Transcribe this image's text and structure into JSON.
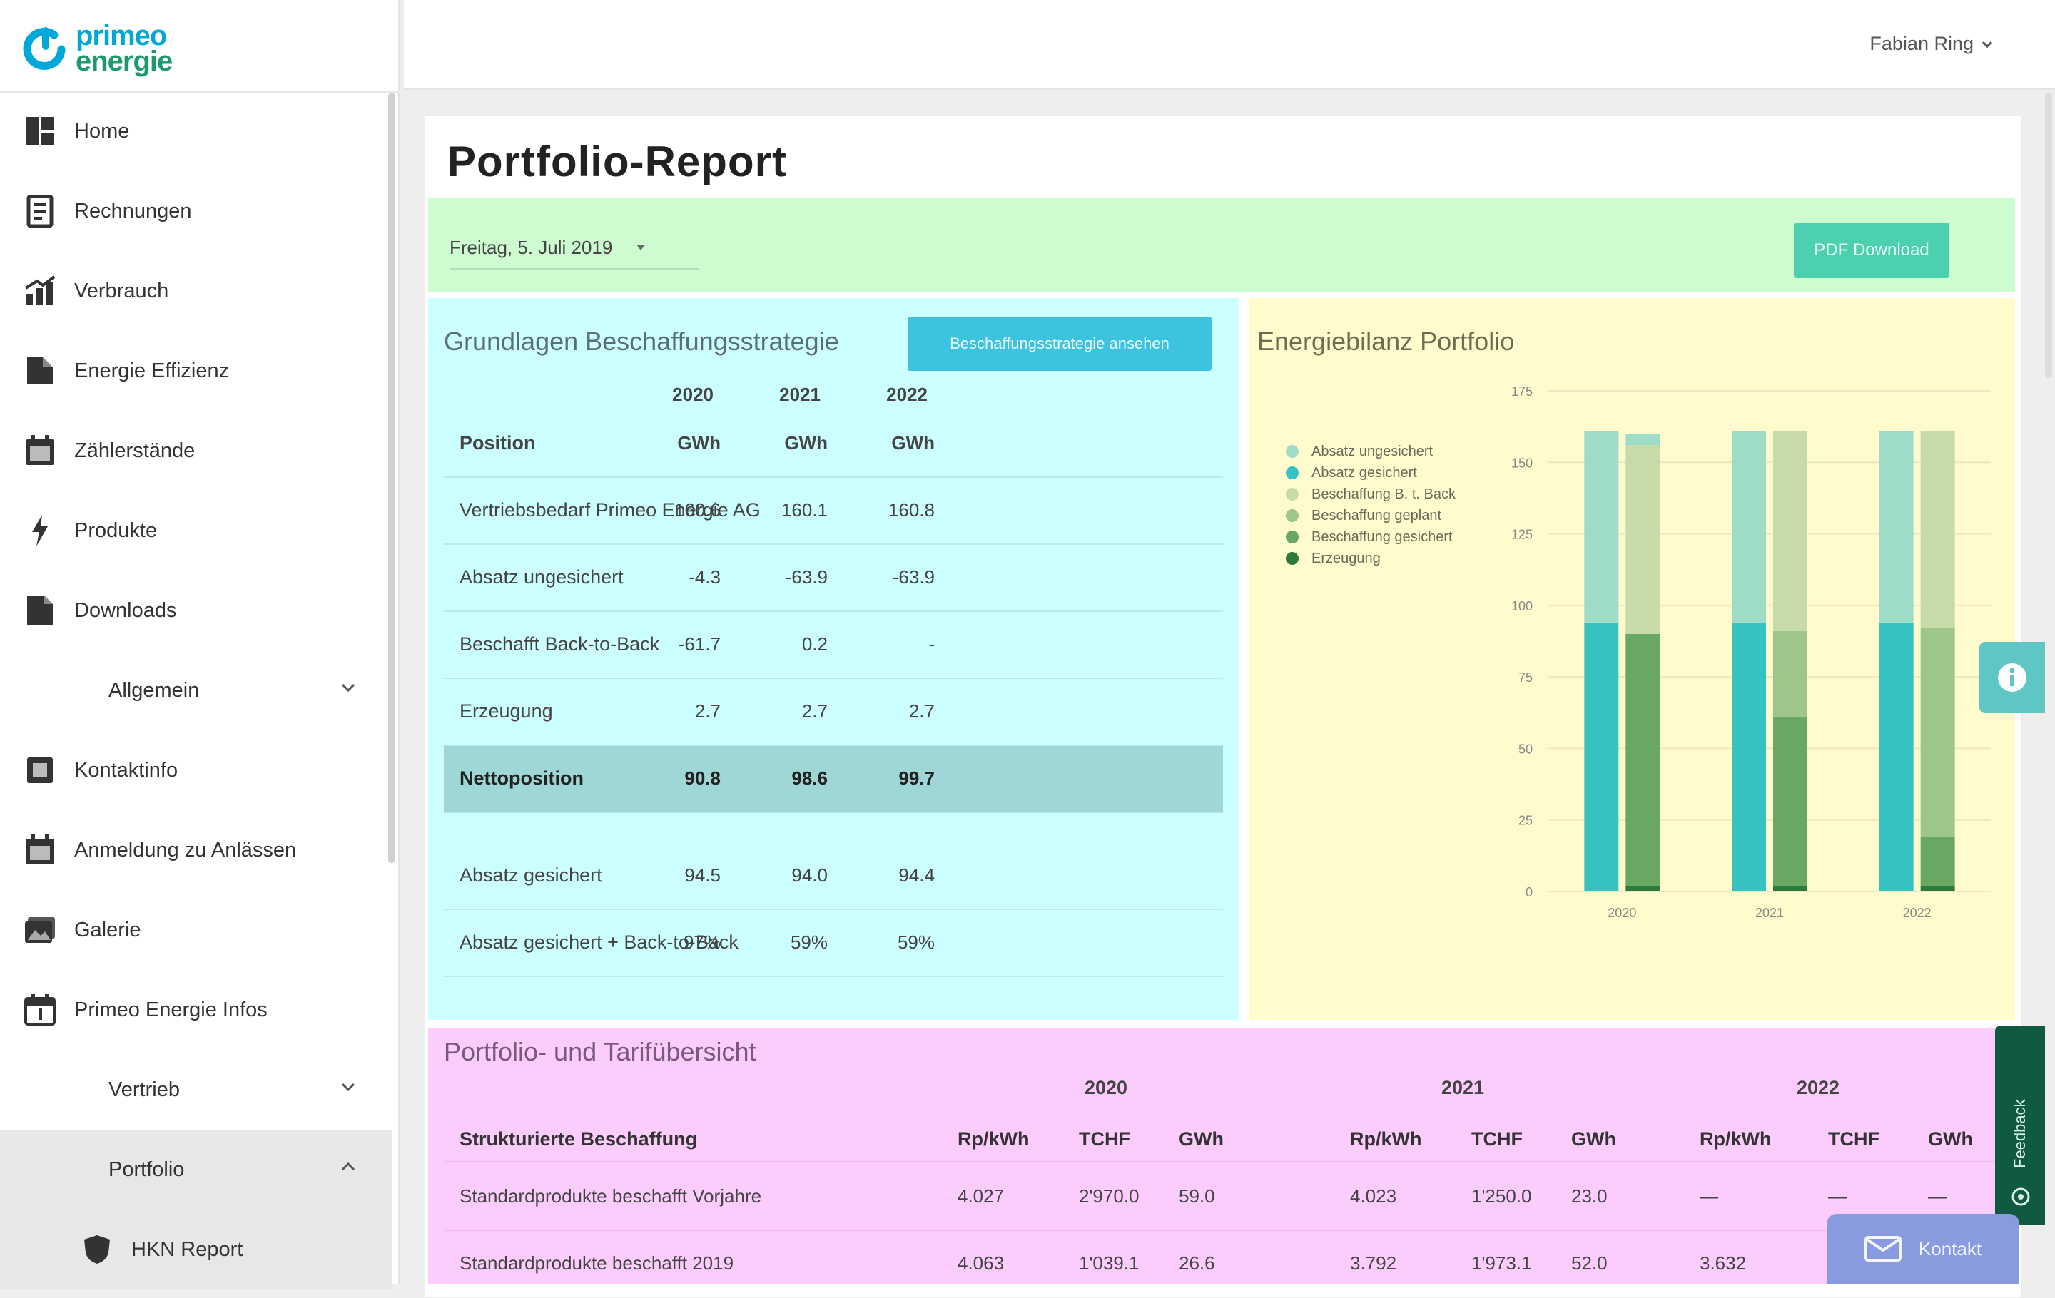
{
  "brand": {
    "line1": "primeo",
    "line2": "energie"
  },
  "user": {
    "name": "Fabian Ring"
  },
  "sidebar": {
    "items": [
      {
        "label": "Home",
        "icon": "dashboard-icon"
      },
      {
        "label": "Rechnungen",
        "icon": "invoice-icon"
      },
      {
        "label": "Verbrauch",
        "icon": "consumption-chart-icon"
      },
      {
        "label": "Energie Effizienz",
        "icon": "efficiency-icon"
      },
      {
        "label": "Zählerstände",
        "icon": "meter-calendar-icon"
      },
      {
        "label": "Produkte",
        "icon": "lightning-plug-icon"
      },
      {
        "label": "Downloads",
        "icon": "download-document-icon"
      },
      {
        "label": "Allgemein",
        "icon": "",
        "expandable": true
      },
      {
        "label": "Kontaktinfo",
        "icon": "contact-icon"
      },
      {
        "label": "Anmeldung zu Anlässen",
        "icon": "event-calendar-icon"
      },
      {
        "label": "Galerie",
        "icon": "gallery-icon"
      },
      {
        "label": "Primeo Energie Infos",
        "icon": "info-calendar-icon"
      },
      {
        "label": "Vertrieb",
        "icon": "",
        "expandable": true
      },
      {
        "label": "Portfolio",
        "icon": "",
        "expandable": true,
        "expanded": true
      },
      {
        "label": "HKN Report",
        "icon": "shield-icon"
      }
    ]
  },
  "page": {
    "title": "Portfolio-Report"
  },
  "toolbar": {
    "date": "Freitag, 5. Juli 2019",
    "pdf_label": "PDF Download"
  },
  "strategy": {
    "title": "Grundlagen Beschaffungsstrategie",
    "button": "Beschaffungsstrategie ansehen",
    "years": [
      "2020",
      "2021",
      "2022"
    ],
    "rows": [
      {
        "label": "Position",
        "values": [
          "GWh",
          "GWh",
          "GWh"
        ],
        "style": "bold"
      },
      {
        "label": "Vertriebsbedarf Primeo Energie AG",
        "values": [
          "160.6",
          "160.1",
          "160.8"
        ]
      },
      {
        "label": "Absatz ungesichert",
        "values": [
          "-4.3",
          "-63.9",
          "-63.9"
        ]
      },
      {
        "label": "Beschafft Back-to-Back",
        "values": [
          "-61.7",
          "0.2",
          "-"
        ]
      },
      {
        "label": "Erzeugung",
        "values": [
          "2.7",
          "2.7",
          "2.7"
        ]
      },
      {
        "label": "Nettoposition",
        "values": [
          "90.8",
          "98.6",
          "99.7"
        ],
        "style": "highlight"
      },
      {
        "label": "",
        "values": [
          "",
          "",
          ""
        ],
        "style": "gap"
      },
      {
        "label": "Absatz gesichert",
        "values": [
          "94.5",
          "94.0",
          "94.4"
        ]
      },
      {
        "label": "Absatz gesichert + Back-to-Back",
        "values": [
          "97%",
          "59%",
          "59%"
        ]
      }
    ]
  },
  "energy": {
    "title": "Energiebilanz Portfolio",
    "legend": [
      {
        "label": "Absatz ungesichert",
        "color": "#9fdcc8"
      },
      {
        "label": "Absatz gesichert",
        "color": "#36c2c0"
      },
      {
        "label": "Beschaffung B. t. Back",
        "color": "#c6dba8"
      },
      {
        "label": "Beschaffung geplant",
        "color": "#9ec58a"
      },
      {
        "label": "Beschaffung gesichert",
        "color": "#68a862"
      },
      {
        "label": "Erzeugung",
        "color": "#2f7a3a"
      }
    ]
  },
  "chart_data": {
    "type": "bar",
    "title": "Energiebilanz Portfolio",
    "categories": [
      "2020",
      "2021",
      "2022"
    ],
    "ylim": [
      0,
      175
    ],
    "yticks": [
      "0",
      "25",
      "50",
      "75",
      "100",
      "125",
      "150",
      "175"
    ],
    "grid": true,
    "legend_position": "left",
    "series_demand": [
      {
        "name": "Absatz gesichert",
        "values": [
          94,
          94,
          94
        ],
        "color": "#36c2c0"
      },
      {
        "name": "Absatz ungesichert",
        "values": [
          67,
          67,
          67
        ],
        "color": "#9fdcc8"
      }
    ],
    "series_supply": [
      {
        "name": "Erzeugung",
        "values": [
          2,
          2,
          2
        ],
        "color": "#2f7a3a"
      },
      {
        "name": "Beschaffung gesichert",
        "values": [
          88,
          59,
          17
        ],
        "color": "#68a862"
      },
      {
        "name": "Beschaffung geplant",
        "values": [
          0,
          30,
          73
        ],
        "color": "#9ec58a"
      },
      {
        "name": "Beschaffung B. t. Back",
        "values": [
          66,
          70,
          69
        ],
        "color": "#c6dba8"
      },
      {
        "name": "Absatz ungesichert",
        "values": [
          4,
          0,
          0
        ],
        "color": "#9fdcc8"
      }
    ]
  },
  "portfolio": {
    "title": "Portfolio- und Tarifübersicht",
    "years": [
      "2020",
      "2021",
      "2022"
    ],
    "first_col_header": "Strukturierte Beschaffung",
    "unit_headers": [
      "Rp/kWh",
      "TCHF",
      "GWh",
      "Rp/kWh",
      "TCHF",
      "GWh",
      "Rp/kWh",
      "TCHF",
      "GWh"
    ],
    "rows": [
      {
        "label": "Standardprodukte beschafft Vorjahre",
        "values": [
          "4.027",
          "2'970.0",
          "59.0",
          "4.023",
          "1'250.0",
          "23.0",
          "—",
          "—",
          "—"
        ]
      },
      {
        "label": "Standardprodukte beschafft 2019",
        "values": [
          "4.063",
          "1'039.1",
          "26.6",
          "3.792",
          "1'973.1",
          "52.0",
          "3.632",
          "",
          ""
        ]
      }
    ]
  },
  "floating": {
    "feedback_label": "Feedback",
    "contact_label": "Kontakt"
  }
}
